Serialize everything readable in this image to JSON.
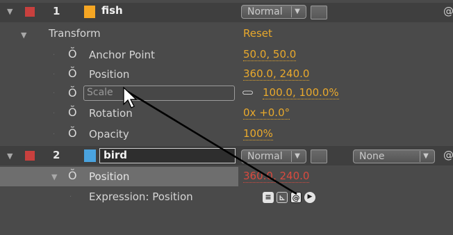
{
  "layers": [
    {
      "number": "1",
      "name": "fish",
      "label_color": "#f5a623",
      "color_box": "#c8403e",
      "mode": "Normal"
    },
    {
      "number": "2",
      "name": "bird",
      "label_color": "#4aa3df",
      "color_box": "#c8403e",
      "mode": "Normal",
      "trkmat": "None"
    }
  ],
  "transform": {
    "label": "Transform",
    "reset": "Reset",
    "props": {
      "anchor_label": "Anchor Point",
      "anchor_value": "50.0, 50.0",
      "position_label": "Position",
      "position_value": "360.0, 240.0",
      "scale_label": "Scale",
      "scale_value": "100.0, 100.0%",
      "rotation_label": "Rotation",
      "rotation_value": "0x +0.0°",
      "opacity_label": "Opacity",
      "opacity_value": "100%"
    }
  },
  "bird_props": {
    "position_label": "Position",
    "position_value": "360.0, 240.0",
    "expression_label": "Expression: Position"
  },
  "icons": {
    "dropdown_arrow": "▼",
    "stopwatch": "Ŏ",
    "link": "⊂⊃",
    "pickwhip": "@",
    "play": "▶"
  }
}
